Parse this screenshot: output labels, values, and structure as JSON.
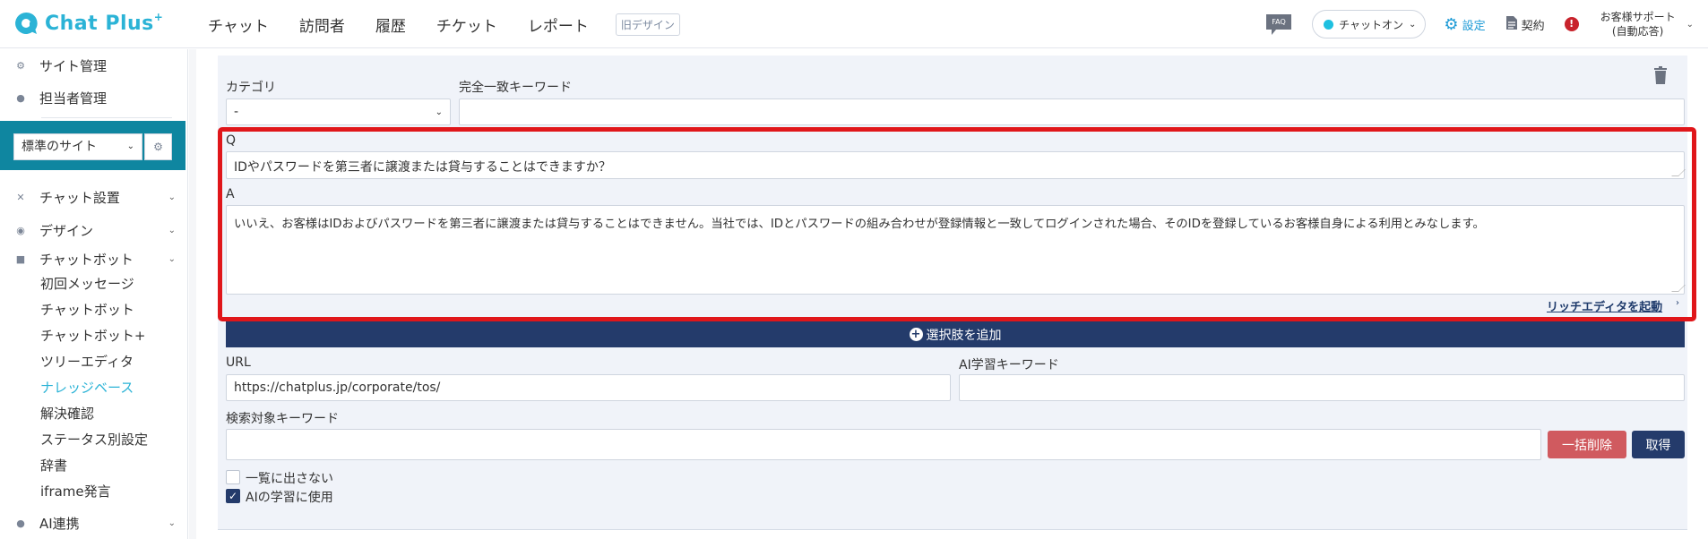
{
  "header": {
    "logo_text": "Chat Plus",
    "logo_sup": "+",
    "nav": [
      "チャット",
      "訪問者",
      "履歴",
      "チケット",
      "レポート"
    ],
    "old_design": "旧デザイン",
    "faq": "FAQ",
    "chat_status": "チャットオン",
    "settings": "設定",
    "contract": "契約",
    "alert": "!",
    "user_line1": "お客様サポート",
    "user_line2": "(自動応答)"
  },
  "sidebar": {
    "site_management": "サイト管理",
    "staff_management": "担当者管理",
    "site_select": "標準のサイト",
    "chat_setup": "チャット設置",
    "design": "デザイン",
    "chatbot": "チャットボット",
    "sub_items": [
      "初回メッセージ",
      "チャットボット",
      "チャットボット+",
      "ツリーエディタ",
      "ナレッジベース",
      "解決確認",
      "ステータス別設定",
      "辞書",
      "iframe発言"
    ],
    "ai_integration": "AI連携"
  },
  "form": {
    "category_label": "カテゴリ",
    "category_value": "-",
    "exact_keyword_label": "完全一致キーワード",
    "exact_keyword_value": "",
    "q_label": "Q",
    "q_value": "IDやパスワードを第三者に譲渡または貸与することはできますか？",
    "a_label": "A",
    "a_value": "いいえ、お客様はIDおよびパスワードを第三者に譲渡または貸与することはできません。当社では、IDとパスワードの組み合わせが登録情報と一致してログインされた場合、そのIDを登録しているお客様自身による利用とみなします。",
    "rich_editor": "リッチエディタを起動",
    "add_choice": "選択肢を追加",
    "url_label": "URL",
    "url_value": "https://chatplus.jp/corporate/tos/",
    "ai_keyword_label": "AI学習キーワード",
    "ai_keyword_value": "",
    "search_keyword_label": "検索対象キーワード",
    "search_keyword_value": "",
    "bulk_delete": "一括削除",
    "fetch": "取得",
    "hide_list_label": "一覧に出さない",
    "hide_list_checked": false,
    "use_ai_label": "AIの学習に使用",
    "use_ai_checked": true
  },
  "colors": {
    "brand": "#2bb3d6",
    "navy": "#243b6b",
    "highlight": "#e0161a",
    "danger": "#d05a5f"
  }
}
